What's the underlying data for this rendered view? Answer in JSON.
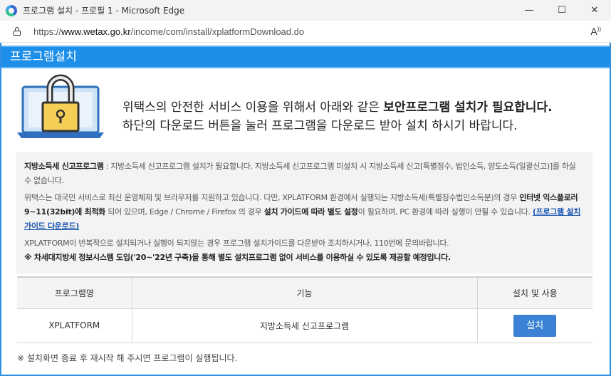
{
  "window": {
    "title": "프로그램 설치 - 프로필 1 - Microsoft Edge",
    "minimize": "—",
    "maximize": "☐",
    "close": "✕"
  },
  "address": {
    "url_prefix": "https://",
    "url_host": "www.wetax.go.kr",
    "url_path": "/income/com/install/xplatformDownload.do",
    "read_aloud": "A"
  },
  "header": {
    "title": "프로그램설치"
  },
  "intro": {
    "line1_plain": "위택스의 안전한 서비스 이용을 위해서 아래와 같은 ",
    "line1_bold": "보안프로그램 설치가 필요합니다.",
    "line2": "하단의 다운로드 버튼을 눌러 프로그램을 다운로드 받아 설치 하시기 바랍니다."
  },
  "notice": {
    "p1_bold": "지방소득세 신고프로그램",
    "p1_text": " : 지방소득세 신고프로그램 설치가 필요합니다. 지방소득세 신고프로그램 미설치 시 지방소득세 신고[특별징수, 법인소득, 양도소득(일괄신고)]를 하실 수 없습니다.",
    "p2_text_a": "위택스는 대국민 서비스로 최신 운영체제 및 브라우저를 지원하고 있습니다. 다만, XPLATFORM 환경에서 실행되는 지방소득세(특별징수법인소득분)의 경우 ",
    "p2_bold_a": "인터넷 익스플로러 9~11(32bit)에 최적화",
    "p2_text_b": " 되어 있으며, Edge / Chrome / Firefox 의 경우 ",
    "p2_bold_b": "설치 가이드에 따라 별도 설정",
    "p2_text_c": "이 필요하며, PC 환경에 따라 실행이 안될 수 있습니다. ",
    "p2_link": "(프로그램 설치 가이드 다운로드)",
    "p3_text": "XPLATFORM이 반복적으로 설치되거나 실행이 되지않는 경우 프로그램 설치가이드를 다운받아 조치하시거나, 110번에 문의바랍니다.",
    "p4_bold": "※ 차세대지방세 정보시스템 도입('20~'22년 구축)을 통해 별도 설치프로그램 없이 서비스를 이용하실 수 있도록 제공할 예정입니다."
  },
  "table": {
    "headers": [
      "프로그램명",
      "기능",
      "설치 및 사용"
    ],
    "rows": [
      {
        "name": "XPLATFORM",
        "function": "지방소득세 신고프로그램",
        "action": "설치"
      }
    ]
  },
  "footer": {
    "note": "※ 설치화면 종료 후 재시작 해 주시면 프로그램이 실행됩니다."
  },
  "colors": {
    "header_blue": "#1e8fe8",
    "button_blue": "#3b82d4",
    "laptop_frame": "#2f6fbd",
    "lock_yellow": "#f5cf55"
  },
  "icons": {
    "app": "edge-logo-icon",
    "lock": "lock-icon",
    "illustration": "laptop-padlock-icon"
  }
}
